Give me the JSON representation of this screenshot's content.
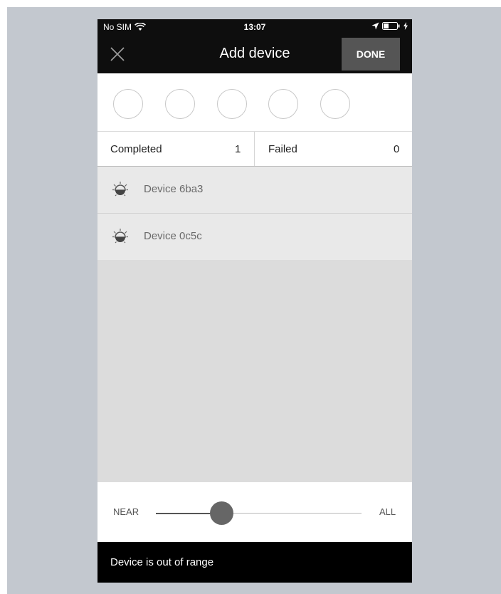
{
  "status_bar": {
    "carrier": "No SIM",
    "time": "13:07"
  },
  "navbar": {
    "title": "Add device",
    "done_label": "DONE",
    "close_icon": "close-icon"
  },
  "progress": {
    "circle_count": 5
  },
  "stats": {
    "completed_label": "Completed",
    "completed_value": "1",
    "failed_label": "Failed",
    "failed_value": "0"
  },
  "devices": [
    {
      "name": "Device 6ba3",
      "icon": "bulb-icon"
    },
    {
      "name": "Device 0c5c",
      "icon": "bulb-icon"
    }
  ],
  "range": {
    "near_label": "NEAR",
    "all_label": "ALL",
    "value_fraction": 0.31
  },
  "toast": {
    "message": "Device is out of range"
  },
  "colors": {
    "backdrop": "#c3c8cf",
    "navbar_bg": "#0e0e0e",
    "done_bg": "#555555",
    "list_bg": "#dcdcdc",
    "row_bg": "#e9e9e9",
    "slider_thumb": "#666666",
    "toast_bg": "#000000"
  }
}
